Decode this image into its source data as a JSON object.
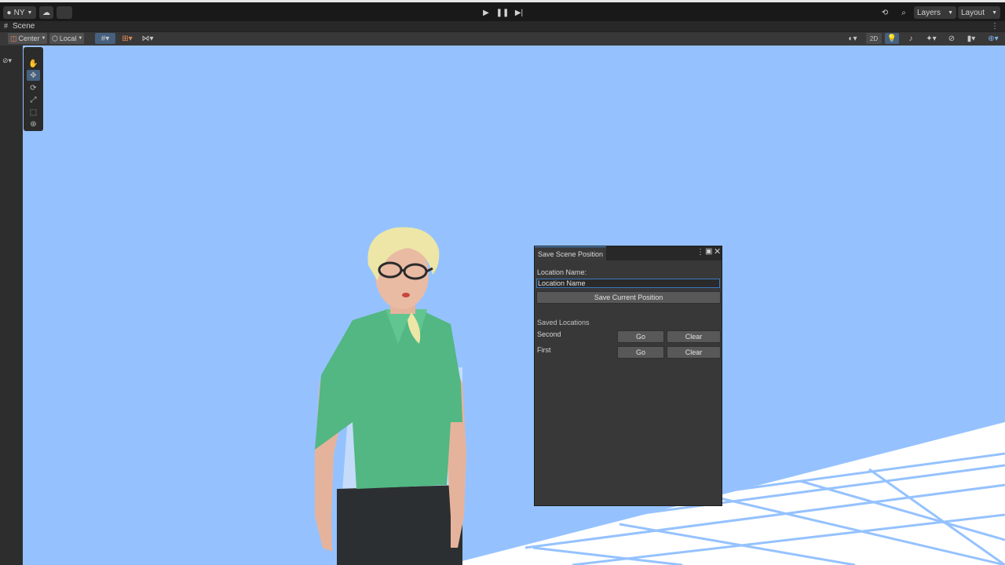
{
  "toolbar": {
    "account_label": "NY",
    "layers_label": "Layers",
    "layout_label": "Layout"
  },
  "scene_tab": {
    "label": "Scene"
  },
  "scene_toolbar": {
    "pivot_label": "Center",
    "space_label": "Local",
    "view_2d_label": "2D"
  },
  "panel": {
    "title": "Save Scene Position",
    "location_name_label": "Location Name:",
    "location_input_value": "Location Name",
    "save_button_label": "Save Current Position",
    "saved_locations_heading": "Saved Locations",
    "locations": [
      {
        "name": "Second",
        "go_label": "Go",
        "clear_label": "Clear"
      },
      {
        "name": "First",
        "go_label": "Go",
        "clear_label": "Clear"
      }
    ]
  },
  "colors": {
    "sky": "#95c2ff",
    "editor_dark": "#191919",
    "panel_bg": "#383838",
    "accent_blue": "#3a79bb",
    "shirt_green": "#52b783",
    "hair_blonde": "#ede6a6"
  }
}
